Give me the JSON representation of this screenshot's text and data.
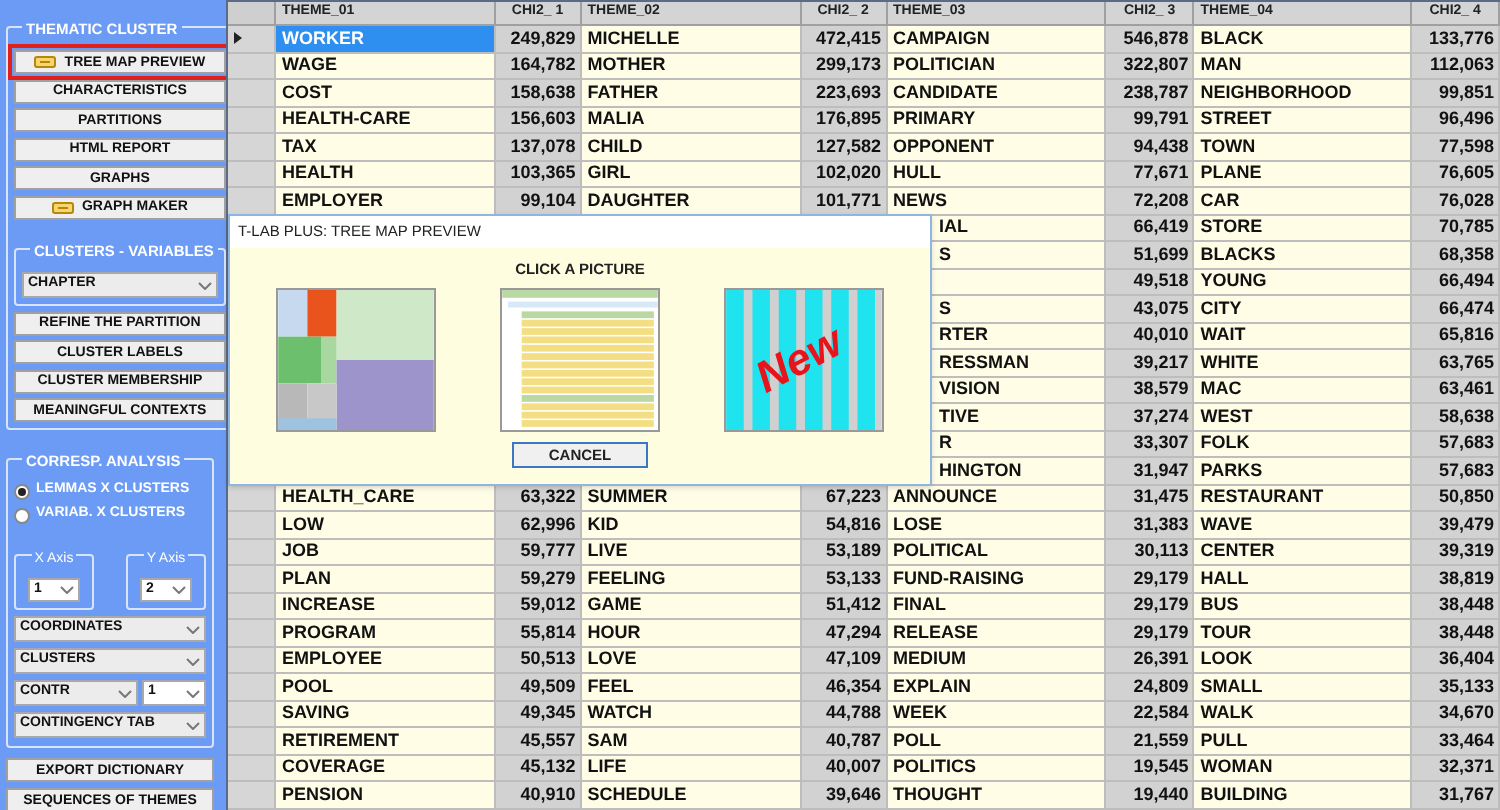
{
  "sidebar": {
    "cluster_group": {
      "title": "THEMATIC CLUSTER",
      "buttons_top": [
        {
          "label": "TREE MAP PREVIEW",
          "icon": true,
          "highlighted": true
        },
        {
          "label": "CHARACTERISTICS",
          "icon": false,
          "highlighted": false
        },
        {
          "label": "PARTITIONS",
          "icon": false,
          "highlighted": false
        },
        {
          "label": "HTML REPORT",
          "icon": false,
          "highlighted": false
        },
        {
          "label": "GRAPHS",
          "icon": false,
          "highlighted": false
        },
        {
          "label": "GRAPH MAKER",
          "icon": true,
          "highlighted": false
        }
      ],
      "variables": {
        "title": "CLUSTERS - VARIABLES",
        "value": "CHAPTER"
      },
      "buttons_bottom": [
        {
          "label": "REFINE THE PARTITION",
          "icon": false,
          "highlighted": false
        },
        {
          "label": "CLUSTER LABELS",
          "icon": false,
          "highlighted": false
        },
        {
          "label": "CLUSTER MEMBERSHIP",
          "icon": false,
          "highlighted": false
        },
        {
          "label": "MEANINGFUL CONTEXTS",
          "icon": false,
          "highlighted": false
        }
      ]
    },
    "corresp_group": {
      "title": "CORRESP. ANALYSIS",
      "radios": [
        {
          "label": "LEMMAS X CLUSTERS",
          "selected": true
        },
        {
          "label": "VARIAB. X CLUSTERS",
          "selected": false
        }
      ],
      "x_axis": {
        "label": "X Axis",
        "value": "1"
      },
      "y_axis": {
        "label": "Y Axis",
        "value": "2"
      },
      "selects": [
        {
          "value": "COORDINATES"
        },
        {
          "value": "CLUSTERS"
        },
        {
          "value": "CONTR",
          "extra": "1"
        },
        {
          "value": "CONTINGENCY TAB"
        }
      ]
    },
    "buttons": [
      {
        "label": "EXPORT DICTIONARY"
      },
      {
        "label": "SEQUENCES OF THEMES"
      }
    ]
  },
  "table": {
    "columns": [
      "THEME_01",
      "CHI2_ 1",
      "THEME_02",
      "CHI2_ 2",
      "THEME_03",
      "CHI2_ 3",
      "THEME_04",
      "CHI2_ 4"
    ],
    "rows": [
      {
        "selected": true,
        "cells": [
          "WORKER",
          "249,829",
          "MICHELLE",
          "472,415",
          "CAMPAIGN",
          "546,878",
          "BLACK",
          "133,776"
        ]
      },
      {
        "selected": false,
        "cells": [
          "WAGE",
          "164,782",
          "MOTHER",
          "299,173",
          "POLITICIAN",
          "322,807",
          "MAN",
          "112,063"
        ]
      },
      {
        "selected": false,
        "cells": [
          "COST",
          "158,638",
          "FATHER",
          "223,693",
          "CANDIDATE",
          "238,787",
          "NEIGHBORHOOD",
          "99,851"
        ]
      },
      {
        "selected": false,
        "cells": [
          "HEALTH-CARE",
          "156,603",
          "MALIA",
          "176,895",
          "PRIMARY",
          "99,791",
          "STREET",
          "96,496"
        ]
      },
      {
        "selected": false,
        "cells": [
          "TAX",
          "137,078",
          "CHILD",
          "127,582",
          "OPPONENT",
          "94,438",
          "TOWN",
          "77,598"
        ]
      },
      {
        "selected": false,
        "cells": [
          "HEALTH",
          "103,365",
          "GIRL",
          "102,020",
          "HULL",
          "77,671",
          "PLANE",
          "76,605"
        ]
      },
      {
        "selected": false,
        "cells": [
          "EMPLOYER",
          "99,104",
          "DAUGHTER",
          "101,771",
          "NEWS",
          "72,208",
          "CAR",
          "76,028"
        ]
      },
      {
        "cells": [
          null,
          null,
          null,
          null,
          "IAL",
          "66,419",
          "STORE",
          "70,785"
        ]
      },
      {
        "cells": [
          null,
          null,
          null,
          null,
          "S",
          "51,699",
          "BLACKS",
          "68,358"
        ]
      },
      {
        "cells": [
          null,
          null,
          null,
          null,
          null,
          "49,518",
          "YOUNG",
          "66,494"
        ]
      },
      {
        "cells": [
          null,
          null,
          null,
          null,
          "S",
          "43,075",
          "CITY",
          "66,474"
        ]
      },
      {
        "cells": [
          null,
          null,
          null,
          null,
          "RTER",
          "40,010",
          "WAIT",
          "65,816"
        ]
      },
      {
        "cells": [
          null,
          null,
          null,
          null,
          "RESSMAN",
          "39,217",
          "WHITE",
          "63,765"
        ]
      },
      {
        "cells": [
          null,
          null,
          null,
          null,
          "VISION",
          "38,579",
          "MAC",
          "63,461"
        ]
      },
      {
        "cells": [
          null,
          null,
          null,
          null,
          "TIVE",
          "37,274",
          "WEST",
          "58,638"
        ]
      },
      {
        "cells": [
          null,
          null,
          null,
          null,
          "R",
          "33,307",
          "FOLK",
          "57,683"
        ]
      },
      {
        "cells": [
          null,
          null,
          null,
          null,
          "HINGTON",
          "31,947",
          "PARKS",
          "57,683"
        ]
      },
      {
        "selected": false,
        "cells": [
          "HEALTH_CARE",
          "63,322",
          "SUMMER",
          "67,223",
          "ANNOUNCE",
          "31,475",
          "RESTAURANT",
          "50,850"
        ]
      },
      {
        "selected": false,
        "cells": [
          "LOW",
          "62,996",
          "KID",
          "54,816",
          "LOSE",
          "31,383",
          "WAVE",
          "39,479"
        ]
      },
      {
        "selected": false,
        "cells": [
          "JOB",
          "59,777",
          "LIVE",
          "53,189",
          "POLITICAL",
          "30,113",
          "CENTER",
          "39,319"
        ]
      },
      {
        "selected": false,
        "cells": [
          "PLAN",
          "59,279",
          "FEELING",
          "53,133",
          "FUND-RAISING",
          "29,179",
          "HALL",
          "38,819"
        ]
      },
      {
        "selected": false,
        "cells": [
          "INCREASE",
          "59,012",
          "GAME",
          "51,412",
          "FINAL",
          "29,179",
          "BUS",
          "38,448"
        ]
      },
      {
        "selected": false,
        "cells": [
          "PROGRAM",
          "55,814",
          "HOUR",
          "47,294",
          "RELEASE",
          "29,179",
          "TOUR",
          "38,448"
        ]
      },
      {
        "selected": false,
        "cells": [
          "EMPLOYEE",
          "50,513",
          "LOVE",
          "47,109",
          "MEDIUM",
          "26,391",
          "LOOK",
          "36,404"
        ]
      },
      {
        "selected": false,
        "cells": [
          "POOL",
          "49,509",
          "FEEL",
          "46,354",
          "EXPLAIN",
          "24,809",
          "SMALL",
          "35,133"
        ]
      },
      {
        "selected": false,
        "cells": [
          "SAVING",
          "49,345",
          "WATCH",
          "44,788",
          "WEEK",
          "22,584",
          "WALK",
          "34,670"
        ]
      },
      {
        "selected": false,
        "cells": [
          "RETIREMENT",
          "45,557",
          "SAM",
          "40,787",
          "POLL",
          "21,559",
          "PULL",
          "33,464"
        ]
      },
      {
        "selected": false,
        "cells": [
          "COVERAGE",
          "45,132",
          "LIFE",
          "40,007",
          "POLITICS",
          "19,545",
          "WOMAN",
          "32,371"
        ]
      },
      {
        "selected": false,
        "cells": [
          "PENSION",
          "40,910",
          "SCHEDULE",
          "39,646",
          "THOUGHT",
          "19,440",
          "BUILDING",
          "31,767"
        ]
      }
    ]
  },
  "dialog": {
    "title": "T-LAB PLUS: TREE MAP PREVIEW",
    "prompt": "CLICK A PICTURE",
    "pictures": [
      {
        "kind": "treemap"
      },
      {
        "kind": "tree"
      },
      {
        "kind": "table",
        "badge": "New"
      }
    ],
    "button": "CANCEL"
  }
}
